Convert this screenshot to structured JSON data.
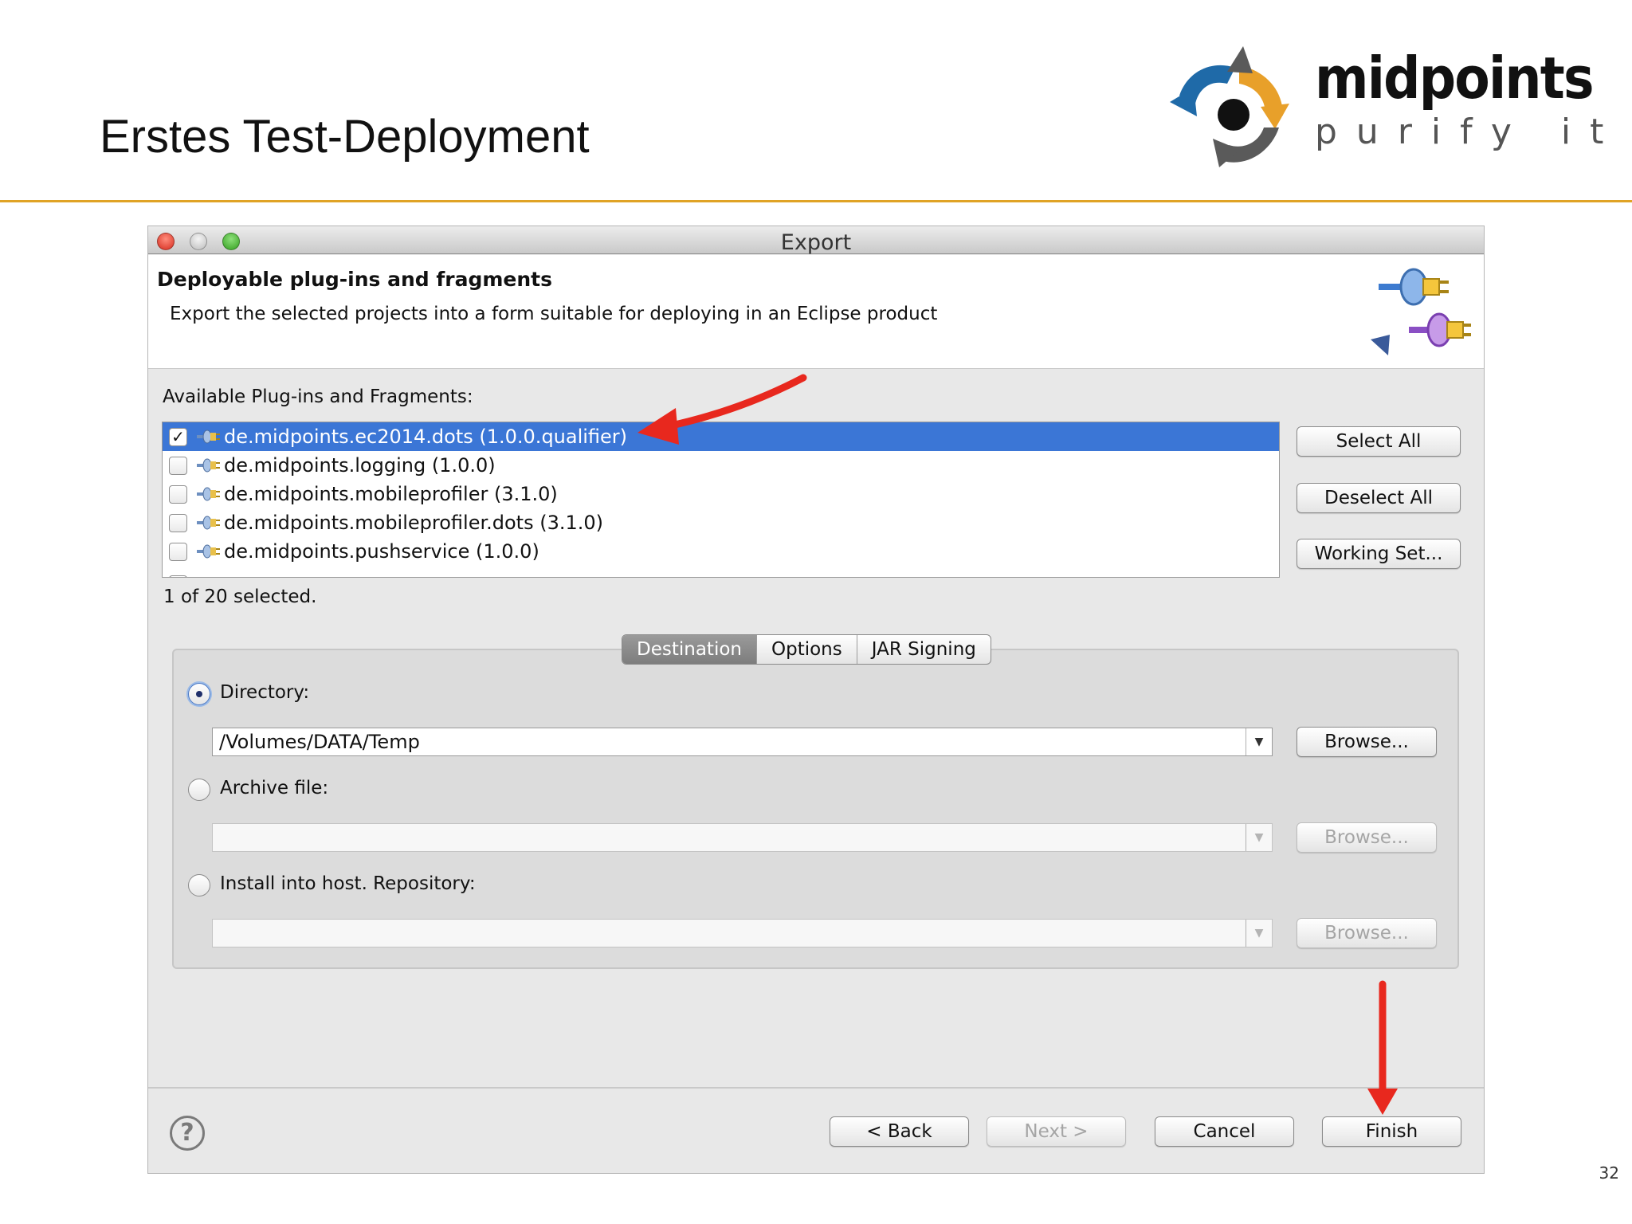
{
  "slide": {
    "title": "Erstes Test-Deployment",
    "page_number": "32",
    "logo": {
      "word": "midpoints",
      "tagline": "purify it"
    }
  },
  "colors": {
    "accent_rule": "#e0a325",
    "selection": "#3b76d6",
    "arrow": "#e8281e"
  },
  "dialog": {
    "window_title": "Export",
    "header": {
      "title": "Deployable plug-ins and fragments",
      "description": "Export the selected projects into a form suitable for deploying in an Eclipse product"
    },
    "list_label": "Available Plug-ins and Fragments:",
    "plugins": [
      {
        "name": "de.midpoints.ec2014.dots (1.0.0.qualifier)",
        "checked": true,
        "selected": true
      },
      {
        "name": "de.midpoints.logging (1.0.0)",
        "checked": false,
        "selected": false
      },
      {
        "name": "de.midpoints.mobileprofiler (3.1.0)",
        "checked": false,
        "selected": false
      },
      {
        "name": "de.midpoints.mobileprofiler.dots (3.1.0)",
        "checked": false,
        "selected": false
      },
      {
        "name": "de.midpoints.pushservice (1.0.0)",
        "checked": false,
        "selected": false
      }
    ],
    "side_buttons": {
      "select_all": "Select All",
      "deselect_all": "Deselect All",
      "working_set": "Working Set..."
    },
    "selection_count": "1 of 20 selected.",
    "tabs": [
      {
        "label": "Destination",
        "active": true
      },
      {
        "label": "Options",
        "active": false
      },
      {
        "label": "JAR Signing",
        "active": false
      }
    ],
    "destination": {
      "directory": {
        "label": "Directory:",
        "value": "/Volumes/DATA/Temp",
        "selected": true,
        "browse": "Browse..."
      },
      "archive": {
        "label": "Archive file:",
        "value": "",
        "selected": false,
        "browse": "Browse..."
      },
      "install": {
        "label": "Install into host. Repository:",
        "value": "",
        "selected": false,
        "browse": "Browse..."
      }
    },
    "footer": {
      "back": "< Back",
      "next": "Next >",
      "cancel": "Cancel",
      "finish": "Finish"
    }
  }
}
